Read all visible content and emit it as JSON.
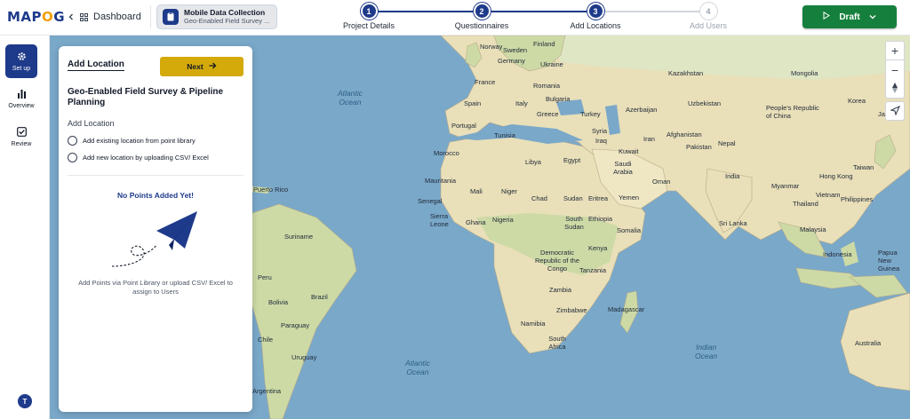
{
  "brand": {
    "logo_main": "MAP",
    "logo_o": "O",
    "logo_end": "G"
  },
  "header": {
    "dashboard_label": "Dashboard",
    "project_title": "Mobile Data Collection",
    "project_subtitle": "Geo-Enabled Field Survey ...",
    "draft_label": "Draft"
  },
  "steps": [
    {
      "num": "1",
      "label": "Project Details"
    },
    {
      "num": "2",
      "label": "Questionnaires"
    },
    {
      "num": "3",
      "label": "Add Locations"
    },
    {
      "num": "4",
      "label": "Add Users"
    }
  ],
  "sidebar": {
    "items": [
      {
        "label": "Set up"
      },
      {
        "label": "Overview"
      },
      {
        "label": "Review"
      }
    ],
    "avatar_initial": "T"
  },
  "panel": {
    "title": "Add Location",
    "next_label": "Next",
    "project_name": "Geo-Enabled Field Survey & Pipeline Planning",
    "section_label": "Add Location",
    "option_library": "Add existing location from point library",
    "option_upload": "Add new location by uploading CSV/ Excel",
    "empty_title": "No Points Added Yet!",
    "empty_desc": "Add Points via Point Library or upload CSV/ Excel to assign to Users"
  },
  "map": {
    "oceans": {
      "atlantic_north_1": "Atlantic",
      "atlantic_north_2": "Ocean",
      "atlantic_south_1": "Atlantic",
      "atlantic_south_2": "Ocean",
      "indian_1": "Indian",
      "indian_2": "Ocean"
    },
    "labels": {
      "finland": "Finland",
      "norway": "Norway",
      "sweden": "Sweden",
      "germany": "Germany",
      "ukraine": "Ukraine",
      "kazakhstan": "Kazakhstan",
      "mongolia": "Mongolia",
      "france": "France",
      "romania": "Romania",
      "bulgaria": "Bulgaria",
      "uzbekistan": "Uzbekistan",
      "spain": "Spain",
      "italy": "Italy",
      "greece": "Greece",
      "turkey": "Turkey",
      "azerbaijan": "Azerbaijan",
      "china": "People's Republic of China",
      "korea": "Korea",
      "japan": "Japan",
      "portugal": "Portugal",
      "tunisia": "Tunisia",
      "syria": "Syria",
      "iraq": "Iraq",
      "iran": "Iran",
      "afghanistan": "Afghanistan",
      "morocco": "Morocco",
      "libya": "Libya",
      "egypt": "Egypt",
      "kuwait": "Kuwait",
      "saudi": "Saudi Arabia",
      "pakistan": "Pakistan",
      "nepal": "Nepal",
      "oman": "Oman",
      "india": "India",
      "taiwan": "Taiwan",
      "hongkong": "Hong Kong",
      "myanmar": "Myanmar",
      "puerto_rico": "Puerto Rico",
      "mauritania": "Mauritania",
      "mali": "Mali",
      "niger": "Niger",
      "chad": "Chad",
      "sudan": "Sudan",
      "eritrea": "Eritrea",
      "yemen": "Yemen",
      "thailand": "Thailand",
      "vietnam": "Vietnam",
      "philippines": "Philippines",
      "senegal": "Senegal",
      "sierra_leone": "Sierra Leone",
      "ghana": "Ghana",
      "nigeria": "Nigeria",
      "south_sudan": "South Sudan",
      "ethiopia": "Ethiopia",
      "somalia": "Somalia",
      "sri_lanka": "Sri Lanka",
      "malaysia": "Malaysia",
      "suriname": "Suriname",
      "kenya": "Kenya",
      "drc": "Democratic Republic of the Congo",
      "indonesia": "Indonesia",
      "png": "Papua New Guinea",
      "tanzania": "Tanzania",
      "brazil": "Brazil",
      "peru": "Peru",
      "bolivia": "Bolivia",
      "zambia": "Zambia",
      "zimbabwe": "Zimbabwe",
      "madagascar": "Madagascar",
      "namibia": "Namibia",
      "paraguay": "Paraguay",
      "chile": "Chile",
      "south_africa": "South Africa",
      "uruguay": "Uruguay",
      "australia": "Australia",
      "argentina": "Argentina"
    }
  },
  "colors": {
    "primary": "#1e3a8a",
    "next_button": "#d4a90a",
    "draft_button": "#15803d",
    "ocean": "#7aa8c9",
    "land": "#e9dfb9"
  }
}
